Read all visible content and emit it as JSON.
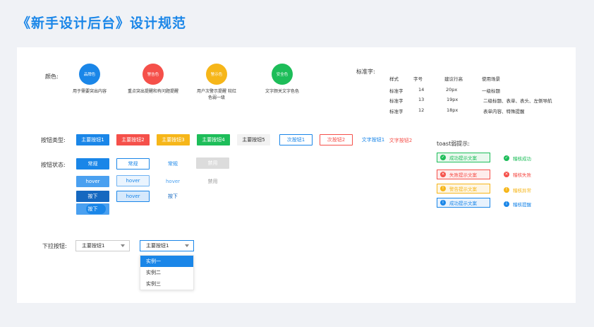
{
  "title": "《新手设计后台》设计规范",
  "colors": {
    "label": "颜色:",
    "items": [
      {
        "name": "品牌色",
        "hex": "#1a86e8",
        "desc": "用于需要突出内容"
      },
      {
        "name": "警告色",
        "hex": "#f5504a",
        "desc": "重点突出提醒和有问题提醒"
      },
      {
        "name": "警示色",
        "hex": "#f6b619",
        "desc": "用户次警示提醒 较红色弱一级"
      },
      {
        "name": "安全色",
        "hex": "#1dbd59",
        "desc": "文字颜关文字色色"
      }
    ]
  },
  "typography": {
    "label": "标准字:",
    "headers": [
      "样式",
      "字号",
      "建议行高",
      "使用场景"
    ],
    "rows": [
      [
        "标准字",
        "14",
        "20px",
        "一级标题"
      ],
      [
        "标准字",
        "13",
        "19px",
        "二级标题、表单、表头、左侧导航"
      ],
      [
        "标准字",
        "12",
        "18px",
        "表单内容、特殊提醒"
      ]
    ]
  },
  "button_types": {
    "label": "按钮类型:",
    "items": [
      "主要按钮1",
      "主要按钮2",
      "主要按钮3",
      "主要按钮4",
      "主要按钮5",
      "次按钮1",
      "次按钮2",
      "文字按钮1",
      "文字按钮2"
    ]
  },
  "button_states": {
    "label": "按钮状态:",
    "normal": "常规",
    "hover": "hover",
    "press": "按下",
    "disabled": "禁用"
  },
  "toast": {
    "label": "toast弱提示:",
    "boxed": [
      "成功提示文案",
      "失败提示文案",
      "警告提示文案",
      "成功提示文案"
    ],
    "plain": [
      "稽核成功",
      "稽核失败",
      "稽核异常",
      "稽核提醒"
    ]
  },
  "dropdown": {
    "label": "下拉按钮:",
    "value": "主要按钮1",
    "options": [
      "实例一",
      "实例二",
      "实例三"
    ]
  }
}
